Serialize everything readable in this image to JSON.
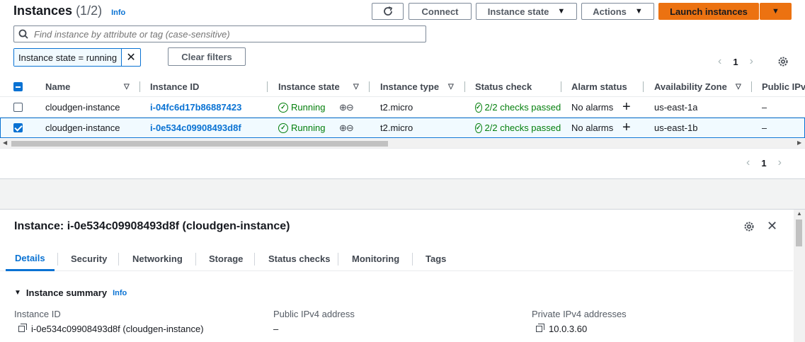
{
  "header": {
    "title": "Instances",
    "count": "(1/2)",
    "info": "Info",
    "buttons": {
      "connect": "Connect",
      "instance_state": "Instance state",
      "actions": "Actions",
      "launch": "Launch instances"
    }
  },
  "search": {
    "placeholder": "Find instance by attribute or tag (case-sensitive)"
  },
  "filter": {
    "token": "Instance state = running",
    "clear": "Clear filters"
  },
  "pagination": {
    "page": "1"
  },
  "table": {
    "columns": [
      "Name",
      "Instance ID",
      "Instance state",
      "Instance type",
      "Status check",
      "Alarm status",
      "Availability Zone",
      "Public IPv"
    ],
    "rows": [
      {
        "name": "cloudgen-instance",
        "id": "i-04fc6d17b86887423",
        "state": "Running",
        "type": "t2.micro",
        "status": "2/2 checks passed",
        "alarm": "No alarms",
        "az": "us-east-1a",
        "ipv4": "–",
        "selected": false
      },
      {
        "name": "cloudgen-instance",
        "id": "i-0e534c09908493d8f",
        "state": "Running",
        "type": "t2.micro",
        "status": "2/2 checks passed",
        "alarm": "No alarms",
        "az": "us-east-1b",
        "ipv4": "–",
        "selected": true
      }
    ]
  },
  "detail": {
    "title": "Instance: i-0e534c09908493d8f (cloudgen-instance)",
    "tabs": [
      "Details",
      "Security",
      "Networking",
      "Storage",
      "Status checks",
      "Monitoring",
      "Tags"
    ],
    "active_tab": "Details",
    "summary_label": "Instance summary",
    "summary_info": "Info",
    "fields": {
      "instance_id_label": "Instance ID",
      "instance_id_value": "i-0e534c09908493d8f (cloudgen-instance)",
      "public_ip_label": "Public IPv4 address",
      "public_ip_value": "–",
      "private_ip_label": "Private IPv4 addresses",
      "private_ip_value": "10.0.3.60"
    }
  },
  "colors": {
    "accent": "#0972d3",
    "primary": "#ec7211",
    "success": "#037f0c"
  }
}
